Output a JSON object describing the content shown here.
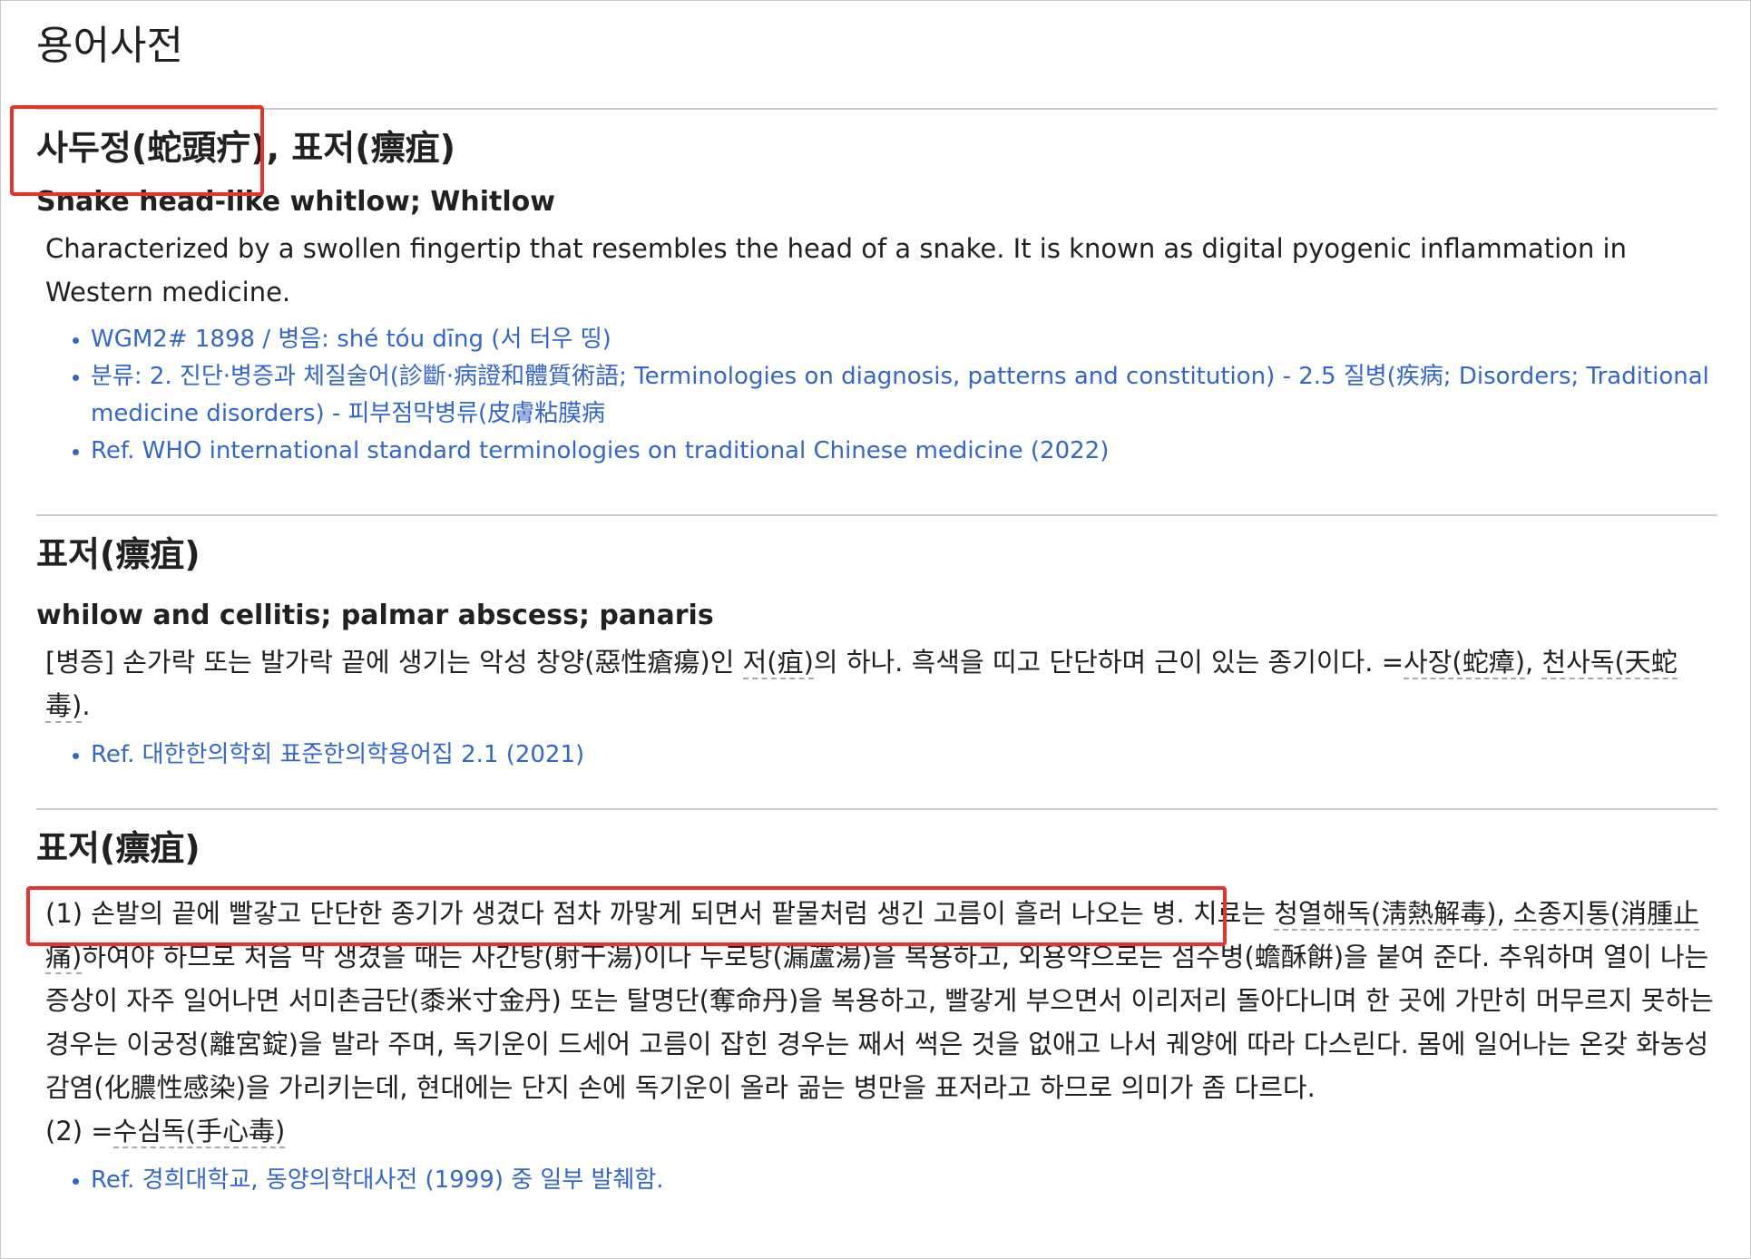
{
  "page": {
    "title": "용어사전"
  },
  "entries": [
    {
      "term_a": "사두정(蛇頭疔)",
      "separator": ",",
      "term_b": "표저(瘭疽)",
      "english": "Snake head-like whitlow; Whitlow",
      "definition": "Characterized by a swollen fingertip that resembles the head of a snake. It is known as digital pyogenic inflammation in Western medicine.",
      "refs": [
        "WGM2# 1898 / 병음: shé tóu dīng (서 터우 띵)",
        "분류: 2. 진단·병증과 체질술어(診斷·病證和體質術語; Terminologies on diagnosis, patterns and constitution) - 2.5 질병(疾病; Disorders; Traditional medicine disorders) - 피부점막병류(皮膚粘膜病",
        "Ref. WHO international standard terminologies on traditional Chinese medicine (2022)"
      ]
    },
    {
      "term": "표저(瘭疽)",
      "english": "whilow and cellitis; palmar abscess; panaris",
      "definition_p1": "[병증] 손가락 또는 발가락 끝에 생기는 악성 창양(惡性瘡瘍)인 ",
      "definition_link1": "저(疽)",
      "definition_p2": "의 하나. 흑색을 띠고 단단하며 근이 있는 종기이다. =",
      "definition_link2": "사장(蛇瘴)",
      "definition_p3": ", ",
      "definition_link3": "천사독(天蛇毒)",
      "definition_p4": ".",
      "refs": [
        "Ref. 대한한의학회 표준한의학용어집 2.1 (2021)"
      ]
    },
    {
      "term": "표저(瘭疽)",
      "def1_p1": "(1) 손발의 끝에 빨갛고 단단한 종기가 생겼다 점차 까맣게 되면서 팥물처럼 생긴 고름이 흘러 나오는 병. 치료는 ",
      "def1_link1": "청열해독(淸熱解毒)",
      "def1_p2": ", ",
      "def1_link2": "소종지통(消腫止痛)",
      "def1_p3": "하여야 하므로 처음 막 생겼을 때는 사간탕(射干湯)이나 누로탕(漏蘆湯)을 복용하고, 외용약으로는 섬수병(蟾酥餠)을 붙여 준다. 추워하며 열이 나는 증상이 자주 일어나면 서미촌금단(黍米寸金丹) 또는 탈명단(奪命丹)을 복용하고, 빨갛게 부으면서 이리저리 돌아다니며 한 곳에 가만히 머무르지 못하는 경우는 이궁정(離宮錠)을 발라 주며, 독기운이 드세어 고름이 잡힌 경우는 째서 썩은 것을 없애고 나서 궤양에 따라 다스린다. 몸에 일어나는 온갖 화농성감염(化膿性感染)을 가리키는데, 현대에는 단지 손에 독기운이 올라 곪는 병만을 표저라고 하므로 의미가 좀 다르다.",
      "def2_p1": "(2) =",
      "def2_link": "수심독(手心毒)",
      "refs": [
        "Ref. 경희대학교, 동양의학대사전 (1999) 중 일부 발췌함."
      ]
    }
  ]
}
